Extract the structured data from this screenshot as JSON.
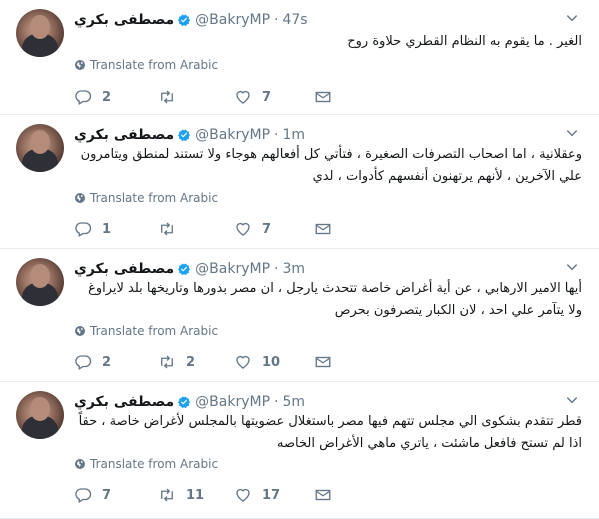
{
  "tweets": [
    {
      "name": "مصطفى بكري",
      "handle": "@BakryMP",
      "separator": "·",
      "time": "47s",
      "text": "الغير . ما يقوم به النظام القطري حلاوة روح",
      "translate": "Translate from Arabic",
      "replies": "2",
      "retweets": "",
      "likes": "7"
    },
    {
      "name": "مصطفى بكري",
      "handle": "@BakryMP",
      "separator": "·",
      "time": "1m",
      "text": "وعقلانية ، اما اصحاب التصرفات الصغيرة ، فتأتي كل أفعالهم هوجاء ولا تستند لمنطق ويتامرون علي الآخرين ، لأنهم يرتهنون أنفسهم كأدوات ، لدي",
      "translate": "Translate from Arabic",
      "replies": "1",
      "retweets": "",
      "likes": "7"
    },
    {
      "name": "مصطفى بكري",
      "handle": "@BakryMP",
      "separator": "·",
      "time": "3m",
      "text": "أيها الامير الارهابي ، عن أية أغراض خاصة تتحدث يارجل ، ان مصر بدورها وتاريخها بلد لايراوغ ولا يتآمر علي احد ، لان الكبار يتصرفون بحرص",
      "translate": "Translate from Arabic",
      "replies": "2",
      "retweets": "2",
      "likes": "10"
    },
    {
      "name": "مصطفى بكري",
      "handle": "@BakryMP",
      "separator": "·",
      "time": "5m",
      "text": "قطر تتقدم بشكوى الي مجلس تتهم فيها مصر باستغلال عضويتها بالمجلس لأغراض خاصة ، حقاً اذا لم تستح فافعل ماشئت ، ياتري ماهي الأغراض الخاصه",
      "translate": "Translate from Arabic",
      "replies": "7",
      "retweets": "11",
      "likes": "17"
    }
  ],
  "icons": {
    "verified": "verified-badge-icon",
    "caret": "chevron-down-icon",
    "globe": "globe-icon",
    "reply": "reply-icon",
    "retweet": "retweet-icon",
    "like": "heart-icon",
    "dm": "envelope-icon"
  },
  "colors": {
    "text": "#14171a",
    "secondary": "#657786",
    "verified": "#1da1f2",
    "divider": "#e6ecf0"
  }
}
